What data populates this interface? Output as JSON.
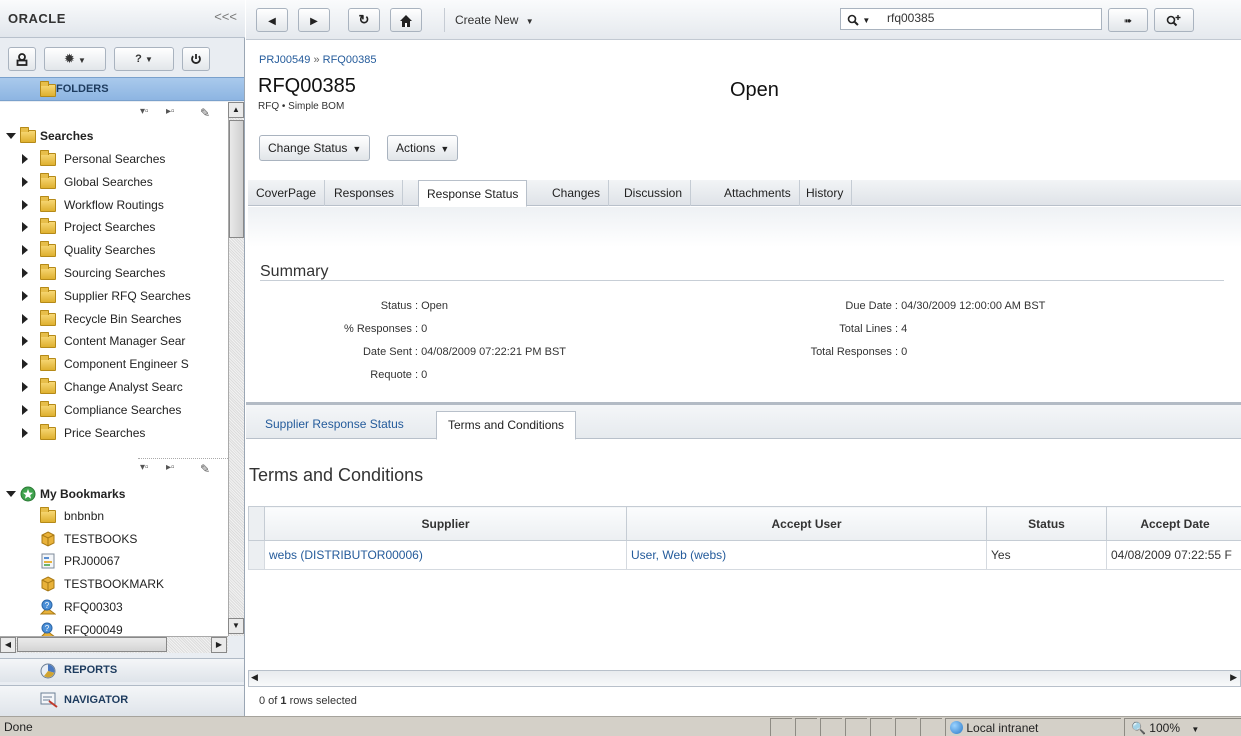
{
  "app": {
    "logo": "ORACLE",
    "collapse_glyph": "<<<"
  },
  "user_bar": {
    "user_icon": "user-icon",
    "settings_icon": "gear-icon",
    "help_label": "?",
    "power_icon": "power-icon"
  },
  "left_nav": {
    "folders_label": "FOLDERS",
    "searches_label": "Searches",
    "searches": [
      "Personal Searches",
      "Global Searches",
      "Workflow Routings",
      "Project Searches",
      "Quality Searches",
      "Sourcing Searches",
      "Supplier RFQ Searches",
      "Recycle Bin Searches",
      "Content Manager Sear",
      "Component Engineer S",
      "Change Analyst Searc",
      "Compliance Searches",
      "Price Searches"
    ],
    "bookmarks_label": "My Bookmarks",
    "bookmarks": [
      {
        "label": "bnbnbn",
        "icon": "folder-icon"
      },
      {
        "label": "TESTBOOKS",
        "icon": "cube-icon"
      },
      {
        "label": "PRJ00067",
        "icon": "project-icon"
      },
      {
        "label": "TESTBOOKMARK",
        "icon": "cube-icon"
      },
      {
        "label": "RFQ00303",
        "icon": "rfq-icon"
      },
      {
        "label": "RFQ00049",
        "icon": "rfq-icon"
      }
    ],
    "reports_label": "REPORTS",
    "navigator_label": "NAVIGATOR"
  },
  "toolbar": {
    "create_new_label": "Create New",
    "search_value": "rfq00385"
  },
  "object": {
    "breadcrumb_parent": "PRJ00549",
    "breadcrumb_sep": "»",
    "breadcrumb_current": "RFQ00385",
    "title": "RFQ00385",
    "subtitle": "RFQ • Simple BOM",
    "status": "Open",
    "change_status_label": "Change Status",
    "actions_label": "Actions"
  },
  "tabs": [
    {
      "label": "CoverPage",
      "active": false
    },
    {
      "label": "Responses",
      "active": false
    },
    {
      "label": "Response Status",
      "active": true
    },
    {
      "label": "Changes",
      "active": false
    },
    {
      "label": "Discussion",
      "active": false
    },
    {
      "label": "Attachments",
      "active": false
    },
    {
      "label": "History",
      "active": false
    }
  ],
  "summary": {
    "heading": "Summary",
    "status_key": "Status :",
    "status_val": "Open",
    "responses_key": "% Responses :",
    "responses_val": "0",
    "date_sent_key": "Date Sent :",
    "date_sent_val": "04/08/2009 07:22:21 PM BST",
    "requote_key": "Requote :",
    "requote_val": "0",
    "due_date_key": "Due Date :",
    "due_date_val": "04/30/2009 12:00:00 AM BST",
    "total_lines_key": "Total Lines :",
    "total_lines_val": "4",
    "total_responses_key": "Total Responses :",
    "total_responses_val": "0"
  },
  "subtabs": [
    {
      "label": "Supplier Response Status",
      "active": false
    },
    {
      "label": "Terms and Conditions",
      "active": true
    }
  ],
  "terms": {
    "heading": "Terms and Conditions",
    "columns": [
      "Supplier",
      "Accept User",
      "Status",
      "Accept Date"
    ],
    "rows": [
      [
        "webs (DISTRIBUTOR00006)",
        "User, Web (webs)",
        "Yes",
        "04/08/2009 07:22:55 F"
      ]
    ],
    "rows_selected_prefix": "0 of",
    "rows_selected_count": "1",
    "rows_selected_suffix": "rows selected"
  },
  "statusbar": {
    "left_text": "Done",
    "zone": "Local intranet",
    "zoom": "100%"
  },
  "colors": {
    "link": "#245b9b",
    "folders_header": "#8db5e2"
  }
}
